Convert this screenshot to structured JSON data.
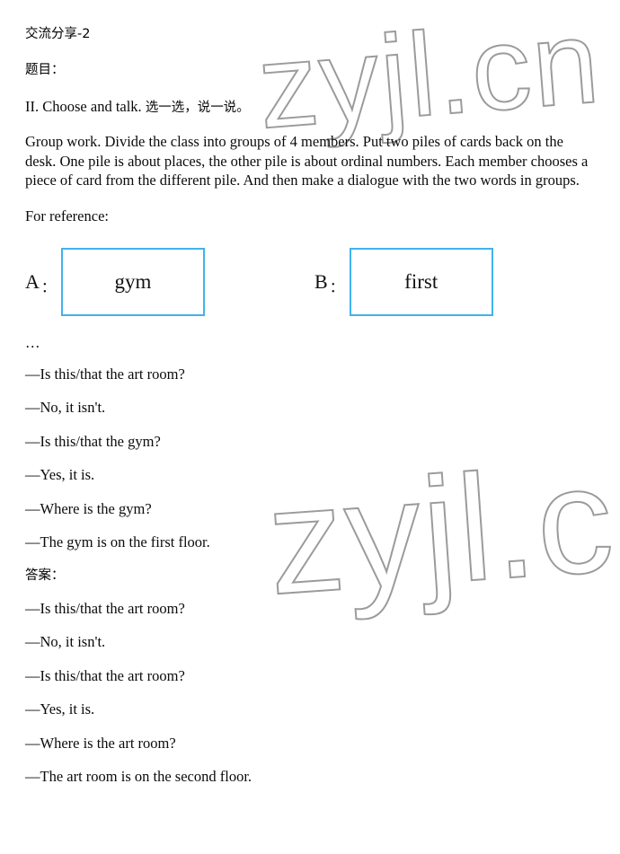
{
  "document": {
    "title": "交流分享-2",
    "prompt_label": "题目：",
    "instruction": "II. Choose and talk. 选一选，说一说。",
    "instruction_en": "II. Choose and talk. ",
    "instruction_cn": "选一选，说一说。",
    "body_paragraph": "Group work. Divide the class into groups of 4 members. Put two piles of cards back on the desk. One pile is about places, the other pile is about ordinal numbers. Each member chooses a piece of card from the different pile. And then make a dialogue with the two words in groups.",
    "reference_label": "For reference:",
    "ellipsis": "…",
    "answer_label": "答案："
  },
  "cards": [
    {
      "letter": "A",
      "colon": "：",
      "word": "gym"
    },
    {
      "letter": "B",
      "colon": "：",
      "word": "first"
    }
  ],
  "reference_dialogue": [
    "—Is this/that the art room?",
    "—No, it isn't.",
    "—Is this/that the gym?",
    "—Yes, it is.",
    "—Where is the gym?",
    "—The gym is on the first floor."
  ],
  "answer_dialogue": [
    "—Is this/that the art room?",
    "—No, it isn't.",
    "—Is this/that the art room?",
    "—Yes, it is.",
    "—Where is the art room?",
    "—The art room is on the second floor."
  ],
  "watermarks": {
    "top": "zyjl.cn",
    "bottom": "zyjl.cn"
  },
  "colors": {
    "card_border": "#3fb3ec",
    "watermark_stroke": "#8a8a8a",
    "text": "#0b0b0b",
    "background": "#ffffff"
  }
}
